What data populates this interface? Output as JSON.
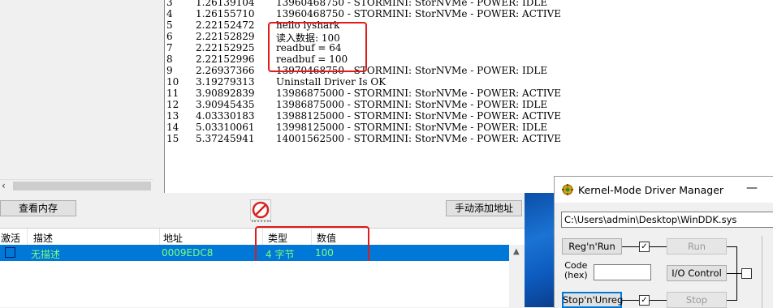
{
  "debug_log": {
    "rows": [
      {
        "num": "3",
        "time": "1.26139104",
        "msg": "13960468750 - STORMINI: StorNVMe - POWER: IDLE"
      },
      {
        "num": "4",
        "time": "1.26155710",
        "msg": "13960468750 - STORMINI: StorNVMe - POWER: ACTIVE"
      },
      {
        "num": "5",
        "time": "2.22152472",
        "msg": "hello lyshark"
      },
      {
        "num": "6",
        "time": "2.22152829",
        "msg": "读入数据: 100"
      },
      {
        "num": "7",
        "time": "2.22152925",
        "msg": "readbuf = 64"
      },
      {
        "num": "8",
        "time": "2.22152996",
        "msg": "readbuf = 100"
      },
      {
        "num": "9",
        "time": "2.26937366",
        "msg": "13970468750 - STORMINI: StorNVMe - POWER: IDLE"
      },
      {
        "num": "10",
        "time": "3.19279313",
        "msg": "Uninstall Driver Is OK"
      },
      {
        "num": "11",
        "time": "3.90892839",
        "msg": "13986875000 - STORMINI: StorNVMe - POWER: ACTIVE"
      },
      {
        "num": "12",
        "time": "3.90945435",
        "msg": "13986875000 - STORMINI: StorNVMe - POWER: IDLE"
      },
      {
        "num": "13",
        "time": "4.03330183",
        "msg": "13988125000 - STORMINI: StorNVMe - POWER: ACTIVE"
      },
      {
        "num": "14",
        "time": "5.03310061",
        "msg": "13998125000 - STORMINI: StorNVMe - POWER: IDLE"
      },
      {
        "num": "15",
        "time": "5.37245941",
        "msg": "14001562500 - STORMINI: StorNVMe - POWER: ACTIVE"
      }
    ]
  },
  "cheat_engine": {
    "view_memory_label": "查看内存",
    "add_address_label": "手动添加地址",
    "columns": {
      "active": "激活",
      "description": "描述",
      "address": "地址",
      "type": "类型",
      "value": "数值"
    },
    "rows": [
      {
        "active": false,
        "description": "无描述",
        "address": "0009EDC8",
        "type": "4 字节",
        "value": "100"
      }
    ]
  },
  "kmdm": {
    "title": "Kernel-Mode Driver Manager",
    "driver_path": "C:\\Users\\admin\\Desktop\\WinDDK.sys",
    "reg_unreg_label": "Reg'n'Run",
    "run_label": "Run",
    "code_label": "Code\n(hex)",
    "io_control_label": "I/O Control",
    "stop_unreg_label": "Stop'n'Unreg",
    "stop_label": "Stop",
    "check_mark": "✓"
  },
  "colors": {
    "highlight_red": "#e01b1b",
    "selection_blue": "#0078d7",
    "selection_text": "#7dff7d"
  }
}
